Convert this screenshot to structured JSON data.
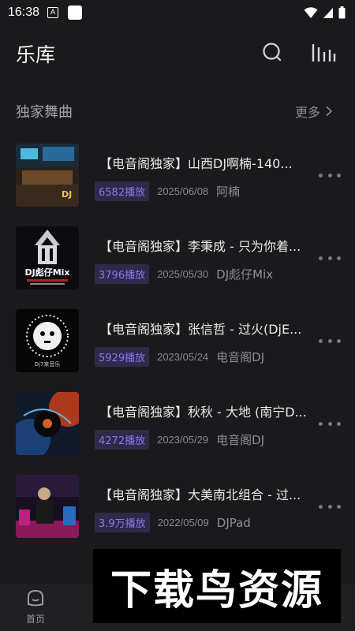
{
  "status_bar": {
    "time": "16:38",
    "app_badge": "A"
  },
  "header": {
    "title": "乐库"
  },
  "section": {
    "title": "独家舞曲",
    "more_label": "更多"
  },
  "songs": [
    {
      "title": "【电音阁独家】山西DJ啊楠-140...",
      "plays": "6582播放",
      "date": "2025/06/08",
      "artist": "阿楠",
      "cover_text": "DJ"
    },
    {
      "title": "【电音阁独家】李秉成 - 只为你着...",
      "plays": "3796播放",
      "date": "2025/05/30",
      "artist": "DJ彪仔Mix",
      "cover_text": "DJ彪仔Mix"
    },
    {
      "title": "【电音阁独家】张信哲 - 过火(DjE...",
      "plays": "5929播放",
      "date": "2023/05/24",
      "artist": "电音阁DJ",
      "cover_text": "Dj7来音乐"
    },
    {
      "title": "【电音阁独家】秋秋 - 大地 (南宁D...",
      "plays": "4272播放",
      "date": "2023/05/29",
      "artist": "电音阁DJ",
      "cover_text": ""
    },
    {
      "title": "【电音阁独家】大美南北组合 - 过...",
      "plays": "3.9万播放",
      "date": "2022/05/09",
      "artist": "DJPad",
      "cover_text": ""
    }
  ],
  "bottom_nav": {
    "home_label": "首页"
  },
  "watermark": {
    "text": "下载鸟资源"
  },
  "colors": {
    "accent": "#8a78f0",
    "badge_bg": "#2f2a4a",
    "background": "#1a1a1c"
  }
}
